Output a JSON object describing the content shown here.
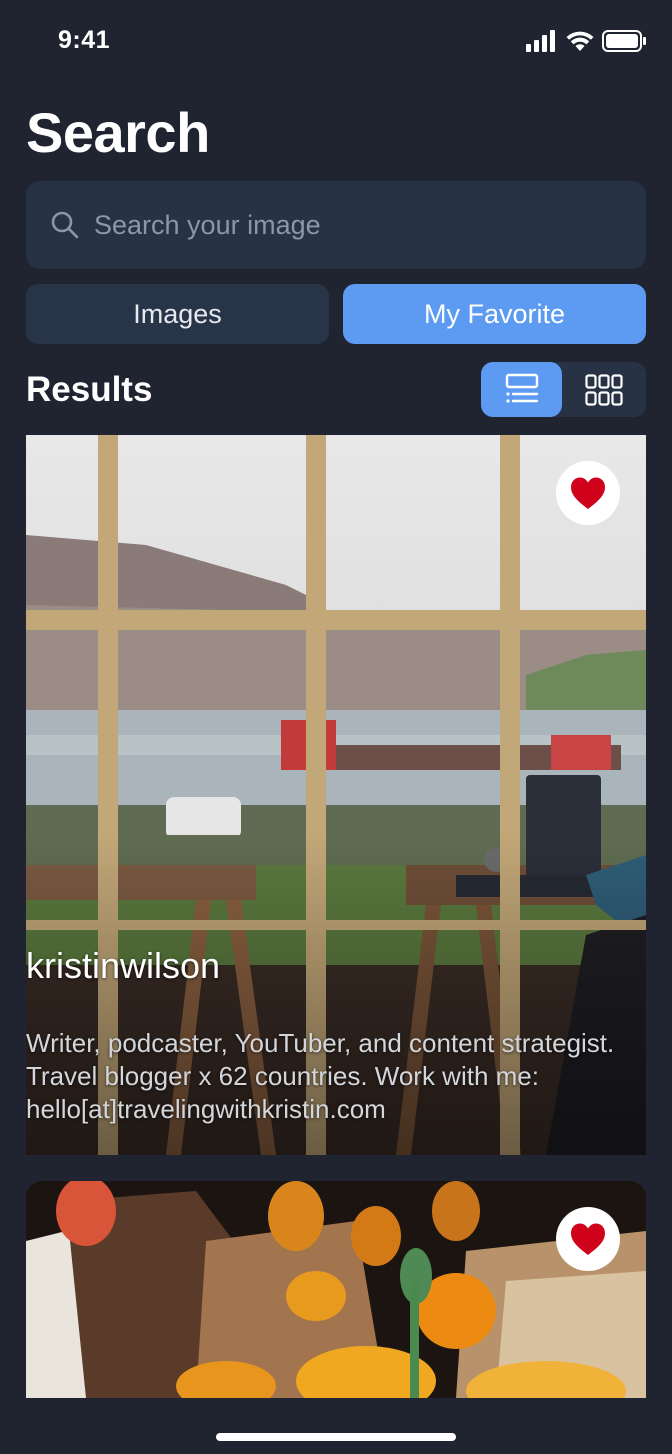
{
  "status_bar": {
    "time": "9:41"
  },
  "header": {
    "title": "Search"
  },
  "search": {
    "placeholder": "Search your image",
    "value": ""
  },
  "tabs": [
    {
      "label": "Images",
      "selected": false
    },
    {
      "label": "My Favorite",
      "selected": true
    }
  ],
  "results": {
    "label": "Results",
    "view_mode": "list",
    "view_modes": [
      "list-view-icon",
      "grid-view-icon"
    ]
  },
  "cards": [
    {
      "username": "kristinwilson",
      "description": "Writer, podcaster, YouTuber, and content strategist. Travel blogger x 62 countries. Work with me: hello[at]travelingwithkristin.com",
      "favorited": true,
      "icon": "heart-icon"
    },
    {
      "favorited": true,
      "icon": "heart-icon"
    }
  ],
  "colors": {
    "background": "#1f2430",
    "surface": "#273244",
    "accent": "#5c9bf1",
    "heart": "#d0021b"
  }
}
